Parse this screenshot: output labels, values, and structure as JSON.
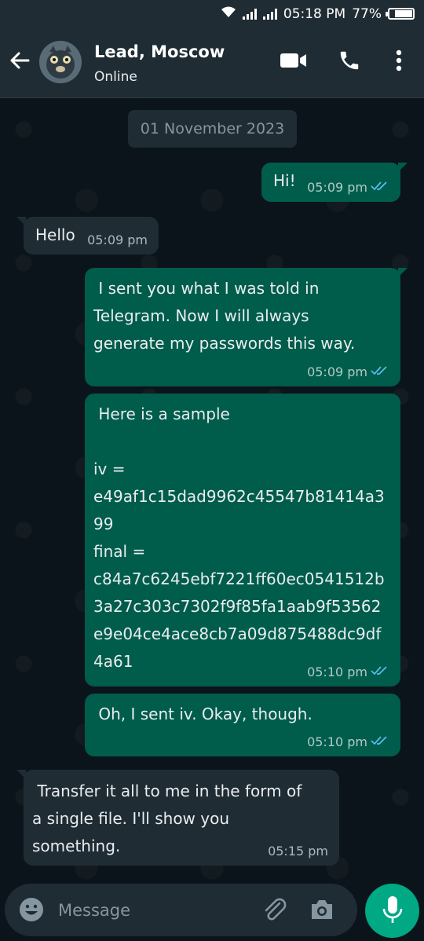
{
  "status_bar": {
    "time": "05:18 PM",
    "battery": "77%",
    "battery_level": 0.77
  },
  "header": {
    "title": "Lead, Moscow",
    "subtitle": "Online"
  },
  "chat": {
    "date": "01 November 2023",
    "messages": [
      {
        "direction": "out",
        "text": "Hi!",
        "time": "05:09 pm",
        "status": "read"
      },
      {
        "direction": "in",
        "text": "Hello",
        "time": "05:09 pm"
      },
      {
        "direction": "out",
        "text": " I sent you what I was told in\nTelegram. Now I will always\ngenerate my passwords this way.",
        "time": "05:09 pm",
        "status": "read"
      },
      {
        "direction": "out",
        "text": " Here is a sample\n\niv =\ne49af1c15dad9962c45547b81414a3\n99\nfinal =\nc84a7c6245ebf7221ff60ec0541512b\n3a27c303c7302f9f85fa1aab9f53562\ne9e04ce4ace8cb7a09d875488dc9df\n4a61",
        "time": "05:10 pm",
        "status": "read"
      },
      {
        "direction": "out",
        "text": " Oh, I sent iv. Okay, though.",
        "time": "05:10 pm",
        "status": "read"
      },
      {
        "direction": "in",
        "text": " Transfer it all to me in the form of\na single file. I'll show you\nsomething.",
        "time": "05:15 pm"
      }
    ]
  },
  "composer": {
    "placeholder": "Message"
  },
  "colors": {
    "outgoing_bubble": "#005c4b",
    "incoming_bubble": "#1f2c34",
    "accent": "#00a884",
    "read_tick": "#53bdeb"
  },
  "icons": [
    "wifi-icon",
    "signal-icon",
    "battery-icon",
    "back-arrow-icon",
    "video-call-icon",
    "phone-icon",
    "more-options-icon",
    "double-check-icon",
    "emoji-icon",
    "attach-icon",
    "camera-icon",
    "mic-icon"
  ]
}
